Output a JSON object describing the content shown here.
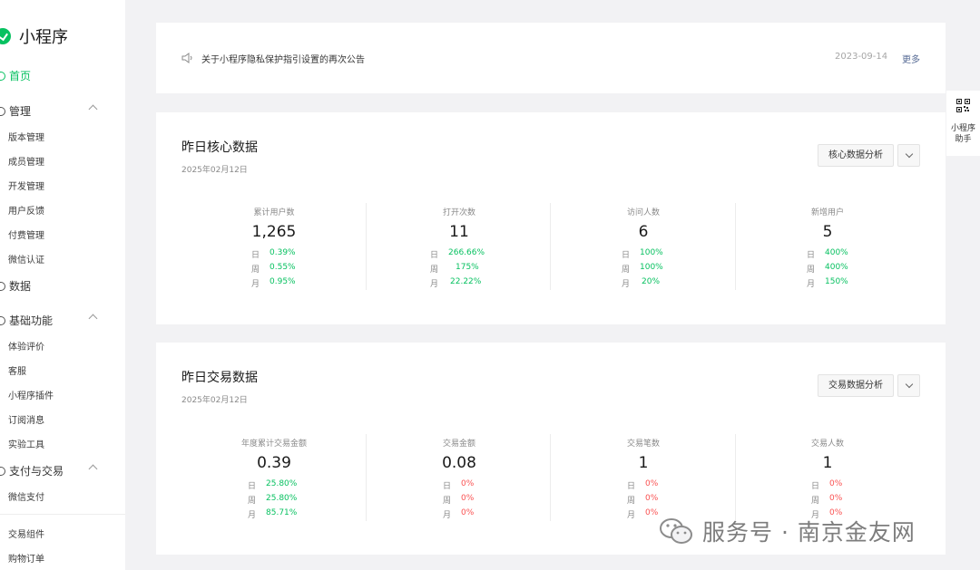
{
  "app": {
    "title": "小程序"
  },
  "sidebar": {
    "home": "首页",
    "manage": {
      "label": "管理",
      "items": [
        "版本管理",
        "成员管理",
        "开发管理",
        "用户反馈",
        "付费管理",
        "微信认证"
      ]
    },
    "data": "数据",
    "basic": {
      "label": "基础功能",
      "items": [
        "体验评价",
        "客服",
        "小程序插件",
        "订阅消息",
        "实验工具"
      ]
    },
    "pay": {
      "label": "支付与交易",
      "items": [
        "微信支付"
      ]
    },
    "extra_items": [
      "交易组件",
      "购物订单"
    ]
  },
  "notice": {
    "text": "关于小程序隐私保护指引设置的再次公告",
    "date": "2023-09-14",
    "more": "更多"
  },
  "core": {
    "title": "昨日核心数据",
    "date": "2025年02月12日",
    "button": "核心数据分析",
    "metrics": [
      {
        "label": "累计用户数",
        "value": "1,265",
        "rows": [
          {
            "k": "日",
            "v": "0.39%"
          },
          {
            "k": "周",
            "v": "0.55%"
          },
          {
            "k": "月",
            "v": "0.95%"
          }
        ]
      },
      {
        "label": "打开次数",
        "value": "11",
        "rows": [
          {
            "k": "日",
            "v": "266.66%"
          },
          {
            "k": "周",
            "v": "175%"
          },
          {
            "k": "月",
            "v": "22.22%"
          }
        ]
      },
      {
        "label": "访问人数",
        "value": "6",
        "rows": [
          {
            "k": "日",
            "v": "100%"
          },
          {
            "k": "周",
            "v": "100%"
          },
          {
            "k": "月",
            "v": "20%"
          }
        ]
      },
      {
        "label": "新增用户",
        "value": "5",
        "rows": [
          {
            "k": "日",
            "v": "400%"
          },
          {
            "k": "周",
            "v": "400%"
          },
          {
            "k": "月",
            "v": "150%"
          }
        ]
      }
    ]
  },
  "trade": {
    "title": "昨日交易数据",
    "date": "2025年02月12日",
    "button": "交易数据分析",
    "metrics": [
      {
        "label": "年度累计交易金额",
        "value": "0.39",
        "rows": [
          {
            "k": "日",
            "v": "25.80%"
          },
          {
            "k": "周",
            "v": "25.80%"
          },
          {
            "k": "月",
            "v": "85.71%"
          }
        ]
      },
      {
        "label": "交易金额",
        "value": "0.08",
        "rows": [
          {
            "k": "日",
            "v": "0%"
          },
          {
            "k": "周",
            "v": "0%"
          },
          {
            "k": "月",
            "v": "0%"
          }
        ]
      },
      {
        "label": "交易笔数",
        "value": "1",
        "rows": [
          {
            "k": "日",
            "v": "0%"
          },
          {
            "k": "周",
            "v": "0%"
          },
          {
            "k": "月",
            "v": "0%"
          }
        ]
      },
      {
        "label": "交易人数",
        "value": "1",
        "rows": [
          {
            "k": "日",
            "v": "0%"
          },
          {
            "k": "周",
            "v": "0%"
          },
          {
            "k": "月",
            "v": "0%"
          }
        ]
      }
    ]
  },
  "helper": {
    "label_line1": "小程序",
    "label_line2": "助手",
    "icon": "qrcode-icon"
  },
  "watermark": {
    "text": "服务号 · 南京金友网"
  },
  "colors": {
    "accent": "#07c160",
    "negative": "#fa5151",
    "link": "#576b95"
  }
}
